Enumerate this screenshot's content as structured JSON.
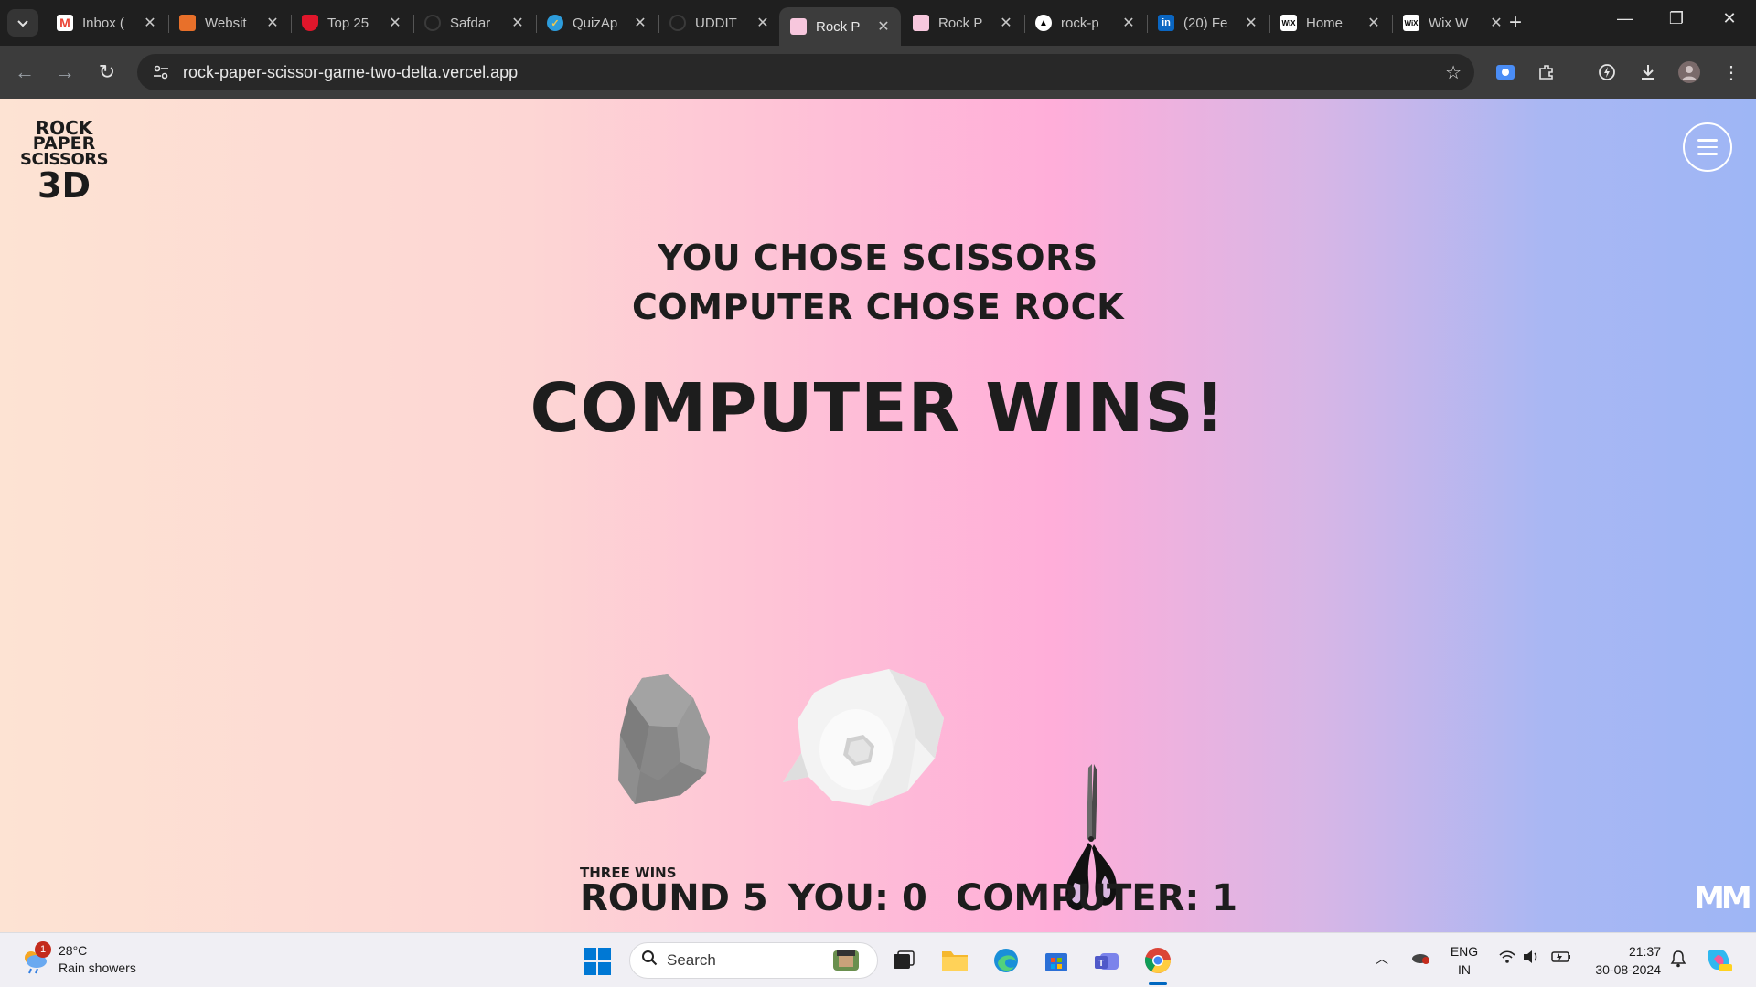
{
  "browser": {
    "tabs": [
      {
        "title": "Inbox (",
        "favicon": "gmail-icon"
      },
      {
        "title": "Websit",
        "favicon": "grid-icon"
      },
      {
        "title": "Top 25",
        "favicon": "shield-icon"
      },
      {
        "title": "Safdar",
        "favicon": "github-icon"
      },
      {
        "title": "QuizAp",
        "favicon": "quiz-icon"
      },
      {
        "title": "UDDIT",
        "favicon": "github-icon"
      },
      {
        "title": "Rock P",
        "favicon": "rps-icon",
        "active": true
      },
      {
        "title": "Rock P",
        "favicon": "rps-icon"
      },
      {
        "title": "rock-p",
        "favicon": "vercel-icon"
      },
      {
        "title": "(20) Fe",
        "favicon": "linkedin-icon"
      },
      {
        "title": "Home",
        "favicon": "wix-icon"
      },
      {
        "title": "Wix W",
        "favicon": "wix-icon"
      }
    ],
    "url": "rock-paper-scissor-game-two-delta.vercel.app"
  },
  "game": {
    "logo": {
      "line1": "ROCK",
      "line2": "PAPER",
      "line3": "SCISSORS",
      "line4": "3D"
    },
    "player_choice_text": "YOU CHOSE SCISSORS",
    "computer_choice_text": "COMPUTER CHOSE ROCK",
    "result_text": "COMPUTER WINS!",
    "choices": [
      "rock",
      "paper",
      "scissors"
    ],
    "mode_label": "THREE WINS",
    "round_text": "ROUND 5",
    "player_score_text": "YOU: 0",
    "computer_score_text": "COMPUTER: 1",
    "footer_logo": "MM"
  },
  "taskbar": {
    "weather_temp": "28°C",
    "weather_desc": "Rain showers",
    "weather_badge": "1",
    "search_placeholder": "Search",
    "lang_line1": "ENG",
    "lang_line2": "IN",
    "time": "21:37",
    "date": "30-08-2024"
  },
  "colors": {
    "accent": "#0078d4",
    "text_dark": "#1d1d1d"
  }
}
